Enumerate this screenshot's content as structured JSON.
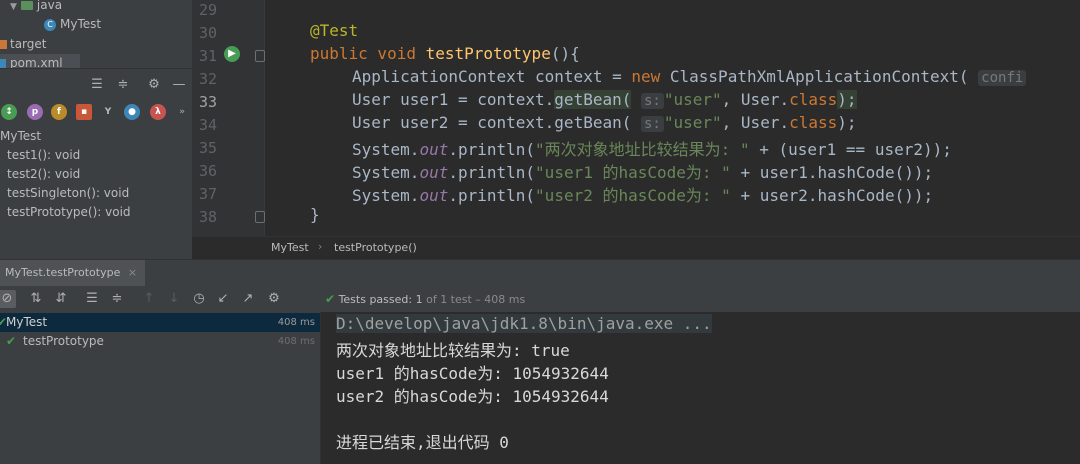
{
  "project_tree": {
    "java_folder": "java",
    "class_file": "MyTest",
    "target_folder": "target",
    "pom_file": "pom.xml"
  },
  "structure": {
    "class_name": "MyTest",
    "methods": [
      "test1(): void",
      "test2(): void",
      "testSingleton(): void",
      "testPrototype(): void"
    ]
  },
  "editor": {
    "line_numbers": [
      "29",
      "30",
      "31",
      "32",
      "33",
      "34",
      "35",
      "36",
      "37",
      "38"
    ],
    "annotation": "@Test",
    "method_kw": "public void ",
    "method_name": "testPrototype",
    "method_end": "(){",
    "line32_type": "ApplicationContext context = ",
    "line32_new": "new ",
    "line32_ctor": "ClassPathXmlApplicationContext(",
    "line32_hint": "confi",
    "line33_start": "User user1 = context.",
    "line34_start": "User user2 = context.",
    "getbean": "getBean(",
    "hint_s": "s:",
    "user_str": "\"user\"",
    "user_class": ", User.",
    "class_kw": "class",
    "line_end": ");",
    "println_start": "System.",
    "out": "out",
    "println": ".println(",
    "line35_str": "\"两次对象地址比较结果为: \"",
    "line35_rest": " + (user1 == user2));",
    "line36_str": "\"user1 的hasCode为: \"",
    "line36_rest": " + user1.hashCode());",
    "line37_str": "\"user2 的hasCode为: \"",
    "line37_rest": " + user2.hashCode());",
    "close_brace": "}"
  },
  "breadcrumb": {
    "class": "MyTest",
    "separator": "›",
    "method": "testPrototype()"
  },
  "run": {
    "tab_label": "MyTest.testPrototype",
    "tab_close": "×",
    "status_prefix": "Tests passed: ",
    "status_count": "1",
    "status_suffix": " of 1 test – 408 ms"
  },
  "test_tree": {
    "root_label": "MyTest",
    "root_time": "408 ms",
    "child_label": "testPrototype",
    "child_time": "408 ms"
  },
  "console": {
    "lines": [
      "D:\\develop\\java\\jdk1.8\\bin\\java.exe ...",
      "两次对象地址比较结果为: true",
      "user1 的hasCode为: 1054932644",
      "user2 的hasCode为: 1054932644",
      "",
      "进程已结束,退出代码 0"
    ]
  },
  "colors": {
    "keyword": "#cc7832",
    "string": "#6a8759",
    "method": "#ffc66d",
    "annotation": "#bbb529",
    "pass": "#499c54"
  }
}
